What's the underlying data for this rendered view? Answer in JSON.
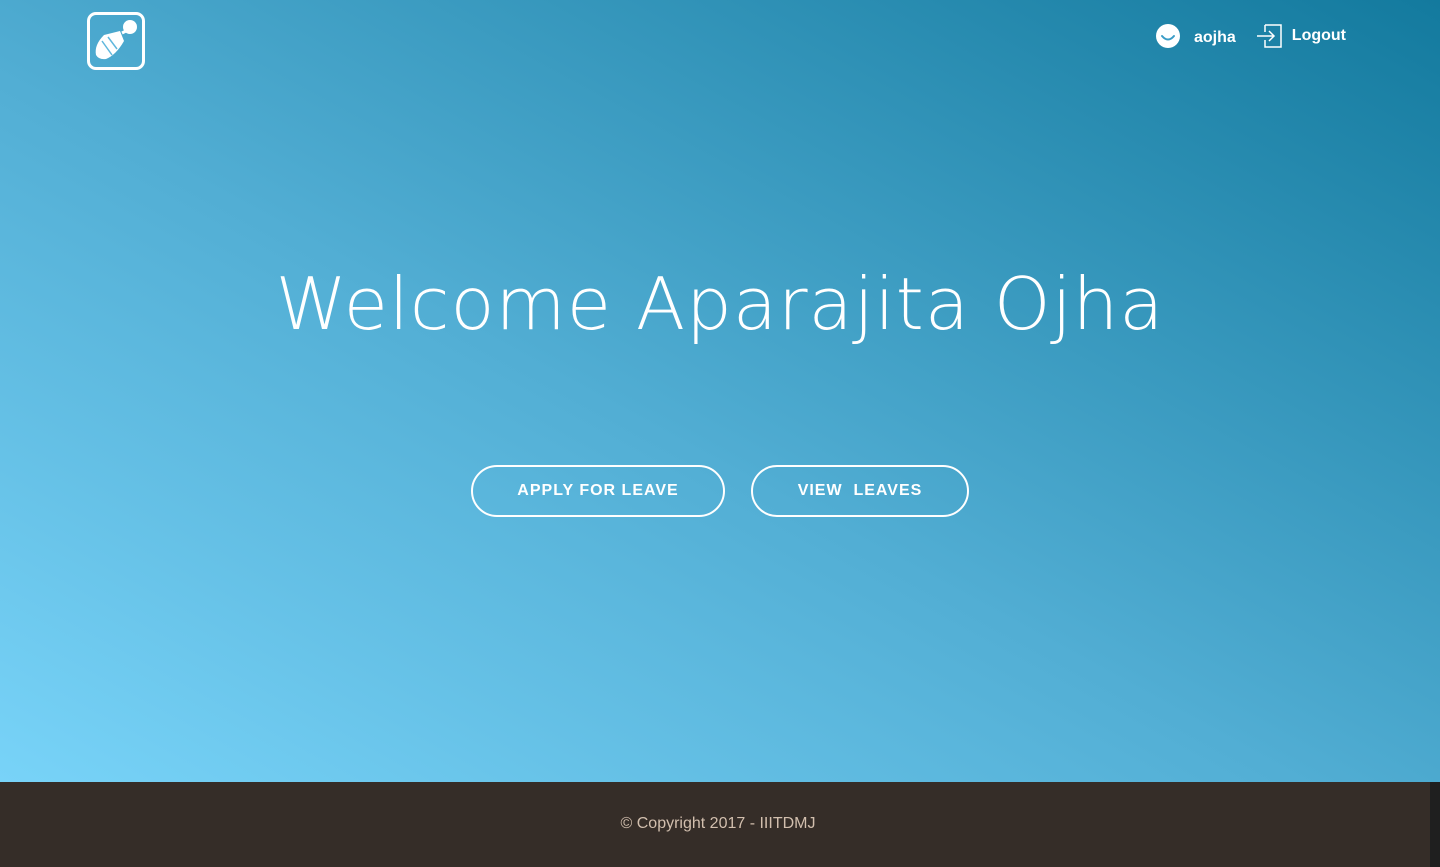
{
  "header": {
    "logo_icon": "shuttlecock-icon",
    "username": "aojha",
    "avatar_icon": "smiley-icon",
    "logout_label": "Logout",
    "logout_icon": "sign-in-arrow-icon"
  },
  "main": {
    "welcome_text": "Welcome Aparajita Ojha",
    "apply_button_label": "APPLY FOR LEAVE",
    "view_button_label": "VIEW  LEAVES"
  },
  "footer": {
    "copyright": "© Copyright 2017 - IIITDMJ"
  },
  "colors": {
    "gradient_light": "#78d3f8",
    "gradient_dark": "#137a9e",
    "footer_bg": "#352d28",
    "footer_text": "#d2bfae"
  }
}
